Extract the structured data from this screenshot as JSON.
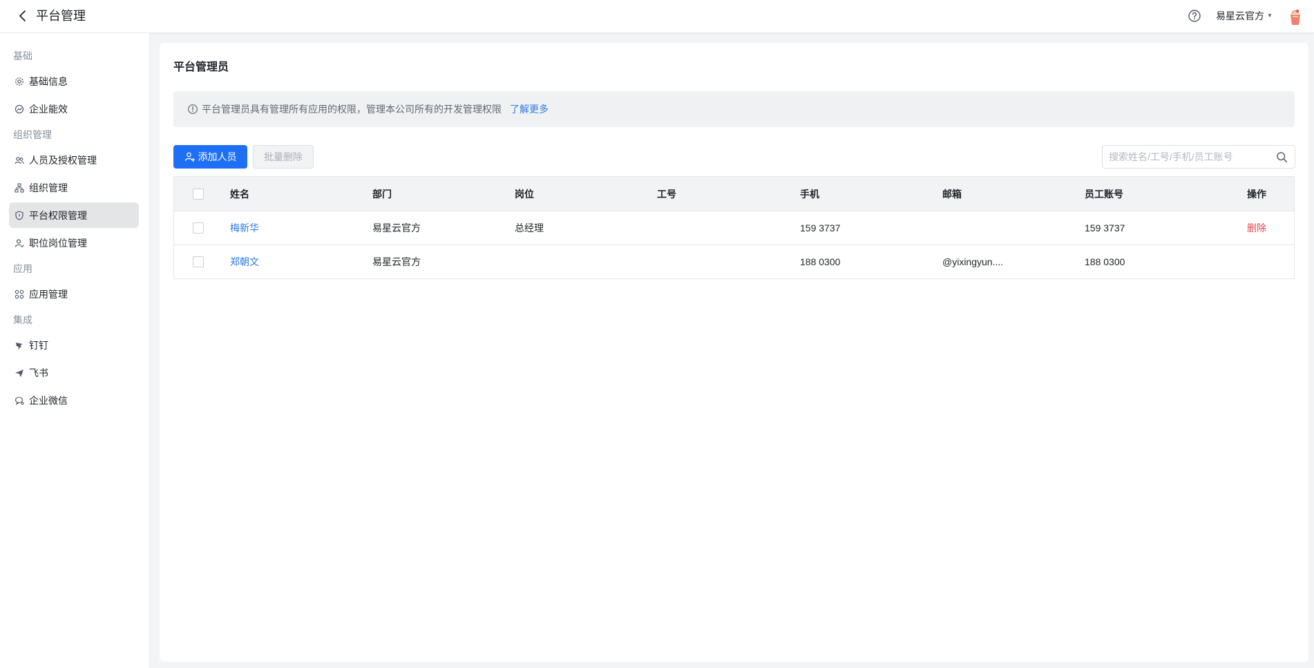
{
  "header": {
    "title": "平台管理",
    "tenant_name": "易星云官方"
  },
  "sidebar": {
    "groups": [
      {
        "label": "基础",
        "items": [
          {
            "label": "基础信息",
            "icon": "gear-icon"
          },
          {
            "label": "企业能效",
            "icon": "chart-icon"
          }
        ]
      },
      {
        "label": "组织管理",
        "items": [
          {
            "label": "人员及授权管理",
            "icon": "users-icon"
          },
          {
            "label": "组织管理",
            "icon": "org-tree-icon"
          },
          {
            "label": "平台权限管理",
            "icon": "shield-icon",
            "active": true
          },
          {
            "label": "职位岗位管理",
            "icon": "user-badge-icon"
          }
        ]
      },
      {
        "label": "应用",
        "items": [
          {
            "label": "应用管理",
            "icon": "apps-grid-icon"
          }
        ]
      },
      {
        "label": "集成",
        "items": [
          {
            "label": "钉钉",
            "icon": "dingtalk-icon"
          },
          {
            "label": "飞书",
            "icon": "feishu-icon"
          },
          {
            "label": "企业微信",
            "icon": "wecom-icon"
          }
        ]
      }
    ]
  },
  "main": {
    "title": "平台管理员",
    "notice": {
      "text": "平台管理员具有管理所有应用的权限，管理本公司所有的开发管理权限",
      "link": "了解更多"
    },
    "add_button": "添加人员",
    "batch_delete_button": "批量删除",
    "search_placeholder": "搜索姓名/工号/手机/员工账号",
    "table": {
      "columns": [
        "姓名",
        "部门",
        "岗位",
        "工号",
        "手机",
        "邮箱",
        "员工账号",
        "操作"
      ],
      "rows": [
        {
          "name": "梅新华",
          "dept": "易星云官方",
          "position": "总经理",
          "employee_no": "",
          "phone": "159 3737",
          "email": "",
          "account": "159 3737",
          "action": "删除"
        },
        {
          "name": "郑朝文",
          "dept": "易星云官方",
          "position": "",
          "employee_no": "",
          "phone": "188 0300",
          "email": "@yixingyun....",
          "account": "188 0300",
          "action": ""
        }
      ]
    }
  },
  "colors": {
    "primary": "#1f6ff5",
    "link": "#2e7ae6",
    "danger": "#e5484d",
    "sidebar_active": "#e4e5e7"
  }
}
